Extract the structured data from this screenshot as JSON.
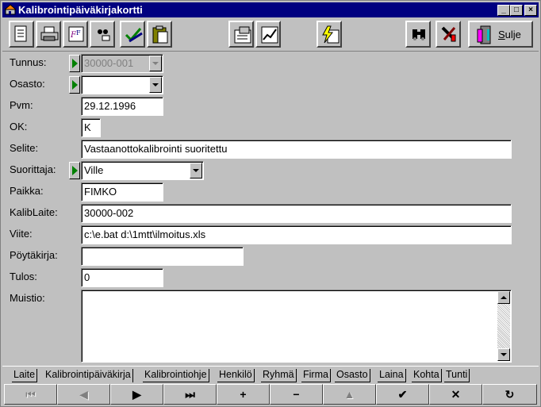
{
  "window": {
    "title": "Kalibrointipäiväkirjakortti",
    "controls": [
      "_",
      "□",
      "×"
    ]
  },
  "toolbar": {
    "icons": [
      "form-icon",
      "printer-icon",
      "font-icon",
      "filter-icon",
      "check-edit-icon",
      "clipboard-icon",
      "report-icon",
      "chart-icon",
      "lightning-form-icon",
      "binoculars-icon",
      "tools-icon"
    ],
    "close_label_underlined": "S",
    "close_label_rest": "ulje"
  },
  "form": {
    "labels": {
      "tunnus": "Tunnus:",
      "osasto": "Osasto:",
      "pvm": "Pvm:",
      "ok": "OK:",
      "selite": "Selite:",
      "suorittaja": "Suorittaja:",
      "paikka": "Paikka:",
      "kalib": "KalibLaite:",
      "viite": "Viite:",
      "poytakirja": "Pöytäkirja:",
      "tulos": "Tulos:",
      "muistio": "Muistio:"
    },
    "values": {
      "tunnus": "30000-001",
      "osasto": "",
      "pvm": "29.12.1996",
      "ok": "K",
      "selite": "Vastaanottokalibrointi suoritettu",
      "suorittaja": "Ville",
      "paikka": "FIMKO",
      "kalib": "30000-002",
      "viite": "c:\\e.bat d:\\1mtt\\ilmoitus.xls",
      "poytakirja": "",
      "tulos": "0",
      "muistio": ""
    }
  },
  "tabs": [
    {
      "label": "Laite",
      "active": false
    },
    {
      "label": "Kalibrointipäiväkirja",
      "active": true
    },
    {
      "label": "Kalibrointiohje",
      "active": false
    },
    {
      "label": "Henkilö",
      "active": false
    },
    {
      "label": "Ryhmä",
      "active": false
    },
    {
      "label": "Firma",
      "active": false
    },
    {
      "label": "Osasto",
      "active": false
    },
    {
      "label": "Laina",
      "active": false
    },
    {
      "label": "Kohta",
      "active": false
    },
    {
      "label": "Tunti",
      "active": false
    }
  ],
  "navigator": {
    "first": "⏮",
    "prior": "◀",
    "next": "▶",
    "last": "⏭",
    "insert": "+",
    "delete": "−",
    "edit": "▲",
    "post": "✔",
    "cancel": "✕",
    "refresh": "↻"
  }
}
